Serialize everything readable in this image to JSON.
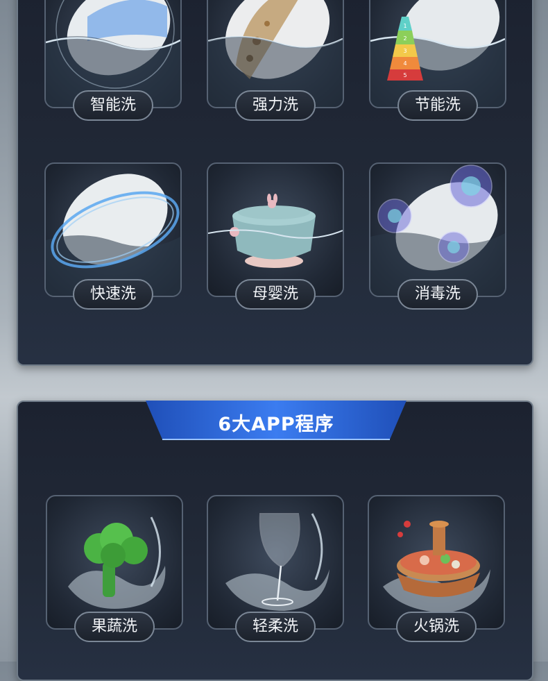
{
  "section_top": {
    "programs": [
      {
        "label": "智能洗",
        "icon": "plate-smart-icon"
      },
      {
        "label": "强力洗",
        "icon": "plate-heavy-icon"
      },
      {
        "label": "节能洗",
        "icon": "plate-eco-icon",
        "eco_levels": [
          "1",
          "2",
          "3",
          "4",
          "5"
        ]
      },
      {
        "label": "快速洗",
        "icon": "plate-quick-icon"
      },
      {
        "label": "母婴洗",
        "icon": "baby-bowl-icon"
      },
      {
        "label": "消毒洗",
        "icon": "plate-sterilize-icon"
      }
    ]
  },
  "section_bottom": {
    "banner_title": "6大APP程序",
    "programs": [
      {
        "label": "果蔬洗",
        "icon": "broccoli-icon"
      },
      {
        "label": "轻柔洗",
        "icon": "wine-glass-icon"
      },
      {
        "label": "火锅洗",
        "icon": "hotpot-icon"
      }
    ]
  },
  "colors": {
    "panel_bg": "#1f2633",
    "banner_blue": "#2f6fe0",
    "pill_border": "#7b8796",
    "water": "#c9dbe8"
  }
}
